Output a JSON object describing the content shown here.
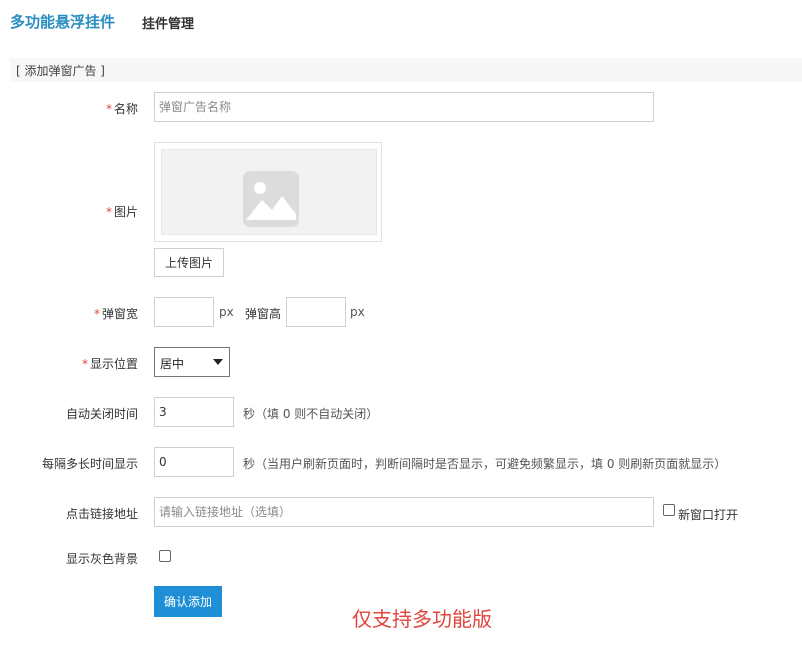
{
  "tabs": {
    "active": "多功能悬浮挂件",
    "other": "挂件管理"
  },
  "section": {
    "title": "[ 添加弹窗广告 ]"
  },
  "form": {
    "required_mark": "*",
    "name": {
      "label": "名称",
      "placeholder": "弹窗广告名称"
    },
    "image": {
      "label": "图片",
      "upload_label": "上传图片"
    },
    "size": {
      "width_label": "弹窗宽",
      "height_label": "弹窗高",
      "unit": "px"
    },
    "position": {
      "label": "显示位置",
      "selected": "居中"
    },
    "auto_close": {
      "label": "自动关闭时间",
      "value": "3",
      "hint": "秒（填 0 则不自动关闭）"
    },
    "interval": {
      "label": "每隔多长时间显示",
      "value": "0",
      "hint": "秒（当用户刷新页面时，判断间隔时是否显示，可避免频繁显示，填 0 则刷新页面就显示）"
    },
    "link": {
      "label": "点击链接地址",
      "placeholder": "请输入链接地址（选填）",
      "new_window_label": "新窗口打开"
    },
    "gray_bg": {
      "label": "显示灰色背景"
    },
    "submit_label": "确认添加"
  },
  "notice": "仅支持多功能版",
  "colors": {
    "accent": "#2a8ec2",
    "button": "#1e8fd6",
    "required": "#e0463c",
    "notice": "#e0463c"
  }
}
